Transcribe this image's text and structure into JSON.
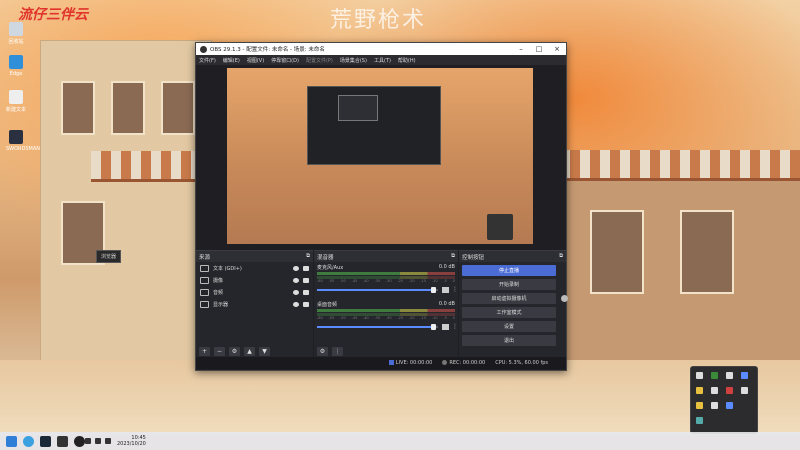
{
  "desktop": {
    "watermark": "流仔三伴云",
    "scene_title": "荒野枪术",
    "icons": [
      {
        "label": "回收站"
      },
      {
        "label": "Edge"
      },
      {
        "label": "新建文本"
      },
      {
        "label": "SWORDSMAN"
      }
    ],
    "tooltip": "浏览器"
  },
  "obs": {
    "title": "OBS 29.1.3 - 配置文件: 未命名 - 场景: 未命名",
    "menu": [
      "文件(F)",
      "编辑(E)",
      "视图(V)",
      "停靠窗口(D)",
      "配置文件(P)",
      "场景集合(S)",
      "工具(T)",
      "帮助(H)"
    ],
    "sources": {
      "header": "来源",
      "items": [
        {
          "name": "文本 (GDI+)",
          "icon": "text-icon"
        },
        {
          "name": "摄像",
          "icon": "camera-icon"
        },
        {
          "name": "音频",
          "icon": "audio-icon"
        },
        {
          "name": "显示器",
          "icon": "monitor-icon"
        }
      ]
    },
    "mixer": {
      "header": "混音器",
      "channels": [
        {
          "name": "麦克风/Aux",
          "db": "0.0 dB",
          "level": 1.0
        },
        {
          "name": "桌面音频",
          "db": "0.0 dB",
          "level": 1.0
        }
      ],
      "ticks": [
        "-60",
        "-55",
        "-50",
        "-45",
        "-40",
        "-35",
        "-30",
        "-25",
        "-20",
        "-15",
        "-10",
        "-5",
        "0"
      ]
    },
    "controls": {
      "header": "控制按钮",
      "buttons": [
        "停止直播",
        "开始录制",
        "启动虚拟摄像机",
        "工作室模式",
        "设置",
        "退出"
      ]
    },
    "status": {
      "live": "LIVE: 00:00:00",
      "rec": "REC: 00:00:00",
      "cpu": "CPU: 5.3%, 60.00 fps"
    }
  },
  "taskbar": {
    "time": "10:45",
    "date": "2023/10/20"
  }
}
